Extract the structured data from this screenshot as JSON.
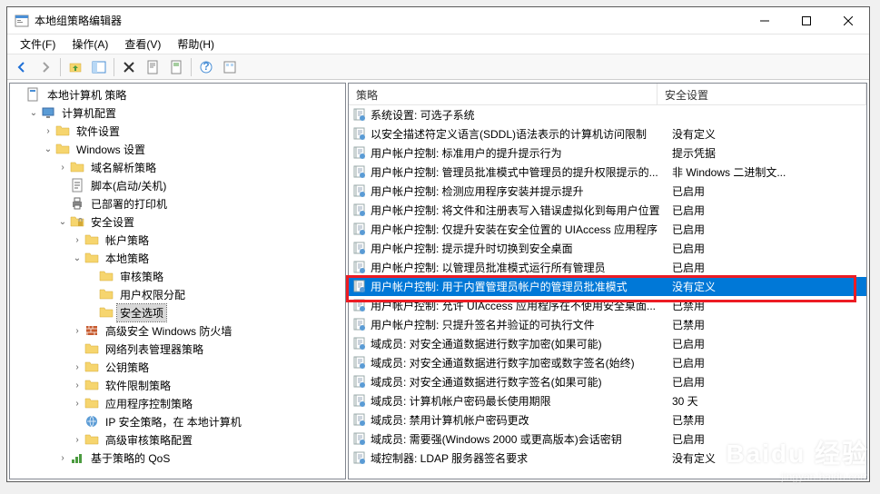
{
  "window": {
    "title": "本地组策略编辑器"
  },
  "menu": {
    "file": "文件(F)",
    "action": "操作(A)",
    "view": "查看(V)",
    "help": "帮助(H)"
  },
  "tree": {
    "root": "本地计算机 策略",
    "computer_cfg": "计算机配置",
    "software": "软件设置",
    "windows": "Windows 设置",
    "dns_policy": "域名解析策略",
    "scripts": "脚本(启动/关机)",
    "printers": "已部署的打印机",
    "security": "安全设置",
    "account_policy": "帐户策略",
    "local_policy": "本地策略",
    "audit_policy": "审核策略",
    "user_rights": "用户权限分配",
    "security_options": "安全选项",
    "firewall": "高级安全 Windows 防火墙",
    "netlist": "网络列表管理器策略",
    "pubkey": "公钥策略",
    "software_restrict": "软件限制策略",
    "app_control": "应用程序控制策略",
    "ipsec": "IP 安全策略，在 本地计算机",
    "audit_adv": "高级审核策略配置",
    "qos": "基于策略的 QoS"
  },
  "headers": {
    "policy": "策略",
    "setting": "安全设置"
  },
  "rows": [
    {
      "p": "系统设置: 可选子系统",
      "s": ""
    },
    {
      "p": "以安全描述符定义语言(SDDL)语法表示的计算机访问限制",
      "s": "没有定义"
    },
    {
      "p": "用户帐户控制: 标准用户的提升提示行为",
      "s": "提示凭据"
    },
    {
      "p": "用户帐户控制: 管理员批准模式中管理员的提升权限提示的...",
      "s": "非 Windows 二进制文..."
    },
    {
      "p": "用户帐户控制: 检测应用程序安装并提示提升",
      "s": "已启用"
    },
    {
      "p": "用户帐户控制: 将文件和注册表写入错误虚拟化到每用户位置",
      "s": "已启用"
    },
    {
      "p": "用户帐户控制: 仅提升安装在安全位置的 UIAccess 应用程序",
      "s": "已启用"
    },
    {
      "p": "用户帐户控制: 提示提升时切换到安全桌面",
      "s": "已启用"
    },
    {
      "p": "用户帐户控制: 以管理员批准模式运行所有管理员",
      "s": "已启用"
    },
    {
      "p": "用户帐户控制: 用于内置管理员帐户的管理员批准模式",
      "s": "没有定义",
      "sel": true
    },
    {
      "p": "用户帐户控制: 允许 UIAccess 应用程序在不使用安全桌面...",
      "s": "已禁用"
    },
    {
      "p": "用户帐户控制: 只提升签名并验证的可执行文件",
      "s": "已禁用"
    },
    {
      "p": "域成员: 对安全通道数据进行数字加密(如果可能)",
      "s": "已启用"
    },
    {
      "p": "域成员: 对安全通道数据进行数字加密或数字签名(始终)",
      "s": "已启用"
    },
    {
      "p": "域成员: 对安全通道数据进行数字签名(如果可能)",
      "s": "已启用"
    },
    {
      "p": "域成员: 计算机帐户密码最长使用期限",
      "s": "30 天"
    },
    {
      "p": "域成员: 禁用计算机帐户密码更改",
      "s": "已禁用"
    },
    {
      "p": "域成员: 需要强(Windows 2000 或更高版本)会话密钥",
      "s": "已启用"
    },
    {
      "p": "域控制器: LDAP 服务器签名要求",
      "s": "没有定义"
    }
  ],
  "watermark": {
    "big": "Baidu 经验",
    "small": "jingyan.baidu.com"
  }
}
